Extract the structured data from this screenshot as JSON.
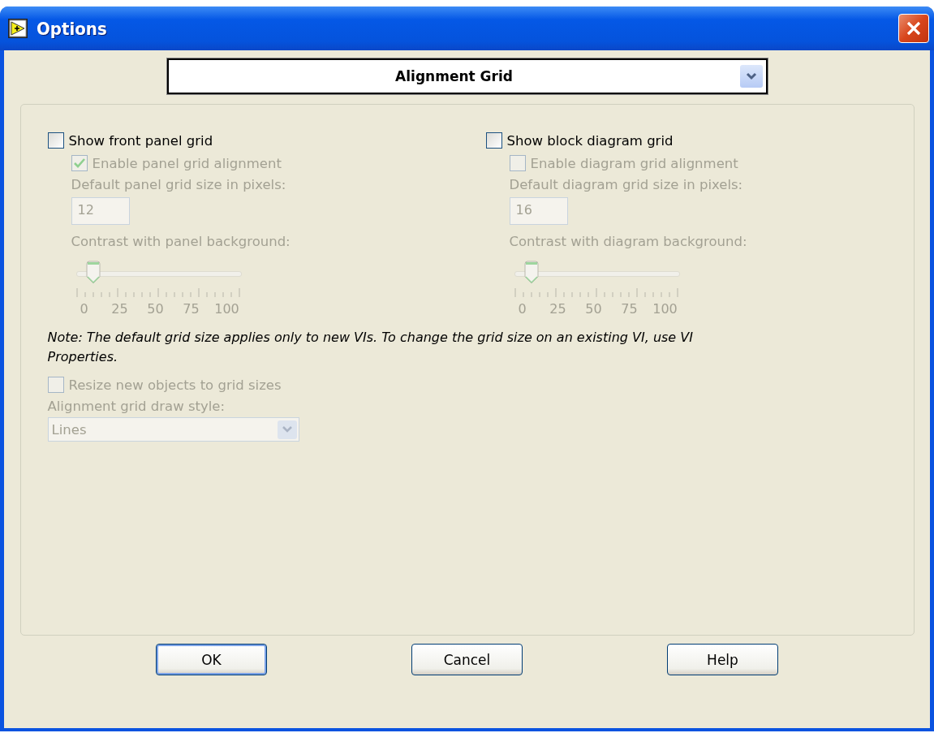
{
  "window": {
    "title": "Options"
  },
  "category_dropdown": {
    "value": "Alignment Grid"
  },
  "columns": [
    {
      "show_grid": {
        "label": "Show front panel grid",
        "checked": false
      },
      "enable_alignment": {
        "label": "Enable panel grid alignment",
        "checked": true,
        "disabled": true
      },
      "size_label": "Default panel grid size in pixels:",
      "size_field": {
        "value": "12",
        "disabled": true
      },
      "contrast_label": "Contrast with panel background:",
      "contrast": {
        "level": 0.1,
        "disabled": true,
        "ticks": [
          "0",
          "25",
          "50",
          "75",
          "100"
        ]
      }
    },
    {
      "show_grid": {
        "label": "Show block diagram grid",
        "checked": false
      },
      "enable_alignment": {
        "label": "Enable diagram grid alignment",
        "checked": false,
        "disabled": true
      },
      "size_label": "Default diagram grid size in pixels:",
      "size_field": {
        "value": "16",
        "disabled": true
      },
      "contrast_label": "Contrast with diagram background:",
      "contrast": {
        "level": 0.1,
        "disabled": true,
        "ticks": [
          "0",
          "25",
          "50",
          "75",
          "100"
        ]
      }
    }
  ],
  "note": "Note: The default grid size applies only to new  VIs. To change the grid size on an existing VI, use VI Properties.",
  "resize": {
    "label": "Resize new objects to grid sizes",
    "checked": false,
    "disabled": true
  },
  "draw_style": {
    "label": "Alignment grid draw style:",
    "value": "Lines",
    "disabled": true
  },
  "buttons": [
    {
      "label": "OK",
      "default": true
    },
    {
      "label": "Cancel",
      "default": false
    },
    {
      "label": "Help",
      "default": false
    }
  ]
}
